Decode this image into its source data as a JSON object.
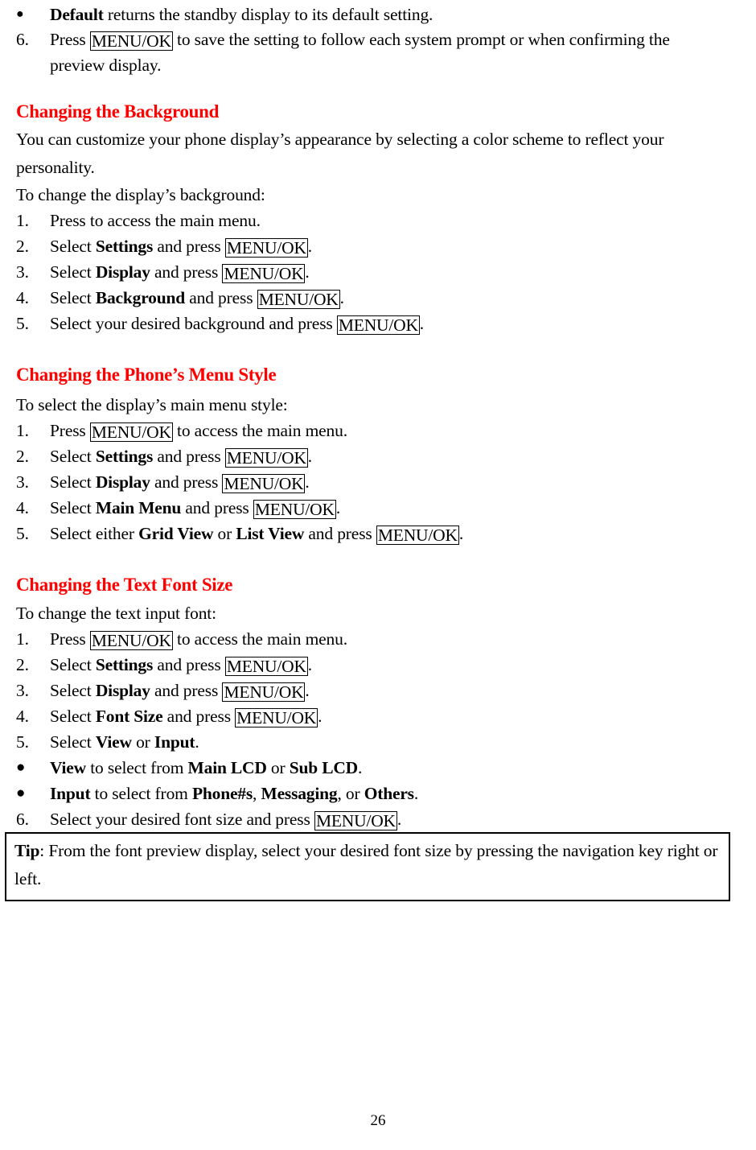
{
  "document": {
    "page_number": "26",
    "heading_color": "#FF0000",
    "text_color": "#000000",
    "key_label": "MENU/OK"
  },
  "top_items": {
    "bullet_default": {
      "bold": "Default",
      "rest": " returns the standby display to its default setting."
    },
    "step6": {
      "number": "6.",
      "pre": "Press ",
      "key": "MENU/OK",
      "post": " to save the setting to follow each system prompt or when confirming the",
      "cont": "preview display."
    }
  },
  "section_background": {
    "heading": "Changing the Background",
    "intro": "You can customize your phone display’s appearance by selecting a color scheme to reflect your personality.",
    "lead": "To change the display’s background:",
    "steps": [
      {
        "number": "1.",
        "pre": "Press to access the main menu.",
        "bold": "",
        "mid": "",
        "key": "",
        "post": ""
      },
      {
        "number": "2.",
        "pre": "Select ",
        "bold": "Settings",
        "mid": " and press ",
        "key": "MENU/OK",
        "post": "."
      },
      {
        "number": "3.",
        "pre": "Select ",
        "bold": "Display",
        "mid": " and press ",
        "key": "MENU/OK",
        "post": "."
      },
      {
        "number": "4.",
        "pre": "Select ",
        "bold": "Background",
        "mid": " and press ",
        "key": "MENU/OK",
        "post": "."
      },
      {
        "number": "5.",
        "pre": "Select your desired background and press ",
        "bold": "",
        "mid": "",
        "key": "MENU/OK",
        "post": "."
      }
    ]
  },
  "section_menu_style": {
    "heading": "Changing the Phone’s Menu Style",
    "lead": "To select the display’s main menu style:",
    "steps": [
      {
        "number": "1.",
        "pre": "Press ",
        "bold": "",
        "mid": "",
        "key": "MENU/OK",
        "post": " to access the main menu."
      },
      {
        "number": "2.",
        "pre": "Select ",
        "bold": "Settings",
        "mid": " and press ",
        "key": "MENU/OK",
        "post": "."
      },
      {
        "number": "3.",
        "pre": "Select ",
        "bold": "Display",
        "mid": " and press ",
        "key": "MENU/OK",
        "post": "."
      },
      {
        "number": "4.",
        "pre": "Select ",
        "bold": "Main Menu",
        "mid": " and press ",
        "key": "MENU/OK",
        "post": "."
      }
    ],
    "step5": {
      "number": "5.",
      "pre": "Select either ",
      "bold1": "Grid View",
      "mid1": " or ",
      "bold2": "List View",
      "mid2": " and press ",
      "key": "MENU/OK",
      "post": "."
    }
  },
  "section_font_size": {
    "heading": "Changing the Text Font Size",
    "lead": "To change the text input font:",
    "steps": [
      {
        "number": "1.",
        "pre": "Press ",
        "bold": "",
        "mid": "",
        "key": "MENU/OK",
        "post": " to access the main menu."
      },
      {
        "number": "2.",
        "pre": "Select ",
        "bold": "Settings",
        "mid": " and press ",
        "key": "MENU/OK",
        "post": "."
      },
      {
        "number": "3.",
        "pre": "Select ",
        "bold": "Display",
        "mid": " and press ",
        "key": "MENU/OK",
        "post": "."
      },
      {
        "number": "4.",
        "pre": "Select ",
        "bold": "Font Size",
        "mid": " and press ",
        "key": "MENU/OK",
        "post": "."
      }
    ],
    "step5": {
      "number": "5.",
      "pre": "Select ",
      "bold1": "View",
      "mid": " or ",
      "bold2": "Input",
      "post": "."
    },
    "bullet_view": {
      "bold1": "View",
      "mid1": " to select from ",
      "bold2": "Main LCD",
      "mid2": " or ",
      "bold3": "Sub LCD",
      "post": "."
    },
    "bullet_input": {
      "bold1": "Input",
      "mid1": " to select from ",
      "bold2": "Phone#s",
      "mid2": ", ",
      "bold3": "Messaging",
      "mid3": ", or ",
      "bold4": "Others",
      "post": "."
    },
    "step6": {
      "number": "6.",
      "pre": "Select your desired font size and press ",
      "key": "MENU/OK",
      "post": "."
    }
  },
  "tip": {
    "label": "Tip",
    "text": ": From the font preview display, select your desired font size by pressing the navigation key right or left."
  }
}
